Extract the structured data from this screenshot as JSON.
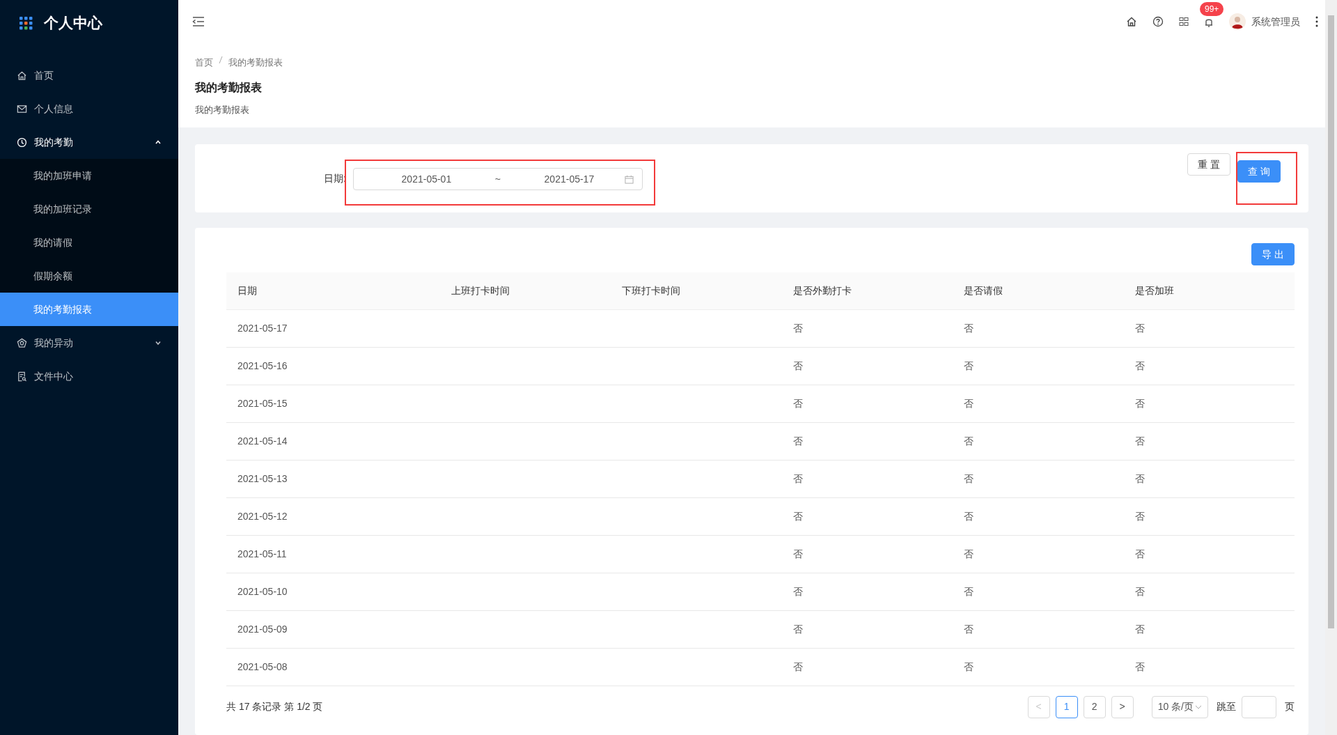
{
  "sidebar": {
    "title": "个人中心",
    "items": [
      {
        "label": "首页"
      },
      {
        "label": "个人信息"
      },
      {
        "label": "我的考勤",
        "expanded": true,
        "children": [
          {
            "label": "我的加班申请",
            "selected": false
          },
          {
            "label": "我的加班记录",
            "selected": false
          },
          {
            "label": "我的请假",
            "selected": false
          },
          {
            "label": "假期余额",
            "selected": false
          },
          {
            "label": "我的考勤报表",
            "selected": true
          }
        ]
      },
      {
        "label": "我的异动",
        "expanded": false
      },
      {
        "label": "文件中心"
      }
    ]
  },
  "header": {
    "notification_count": "99+",
    "user": "系统管理员"
  },
  "breadcrumb": [
    "首页",
    "我的考勤报表"
  ],
  "page_title": "我的考勤报表",
  "page_subtitle": "我的考勤报表",
  "filter": {
    "label": "日期:",
    "start": "2021-05-01",
    "separator": "~",
    "end": "2021-05-17",
    "highlighted": true
  },
  "filter_buttons": [
    {
      "label": "重 置",
      "kind": "default",
      "highlighted": false
    },
    {
      "label": "查 询",
      "kind": "primary",
      "highlighted": true
    }
  ],
  "export_button": "导 出",
  "table": {
    "columns": [
      "日期",
      "上班打卡时间",
      "下班打卡时间",
      "是否外勤打卡",
      "是否请假",
      "是否加班"
    ],
    "rows": [
      [
        "2021-05-17",
        null,
        null,
        "否",
        "否",
        "否"
      ],
      [
        "2021-05-16",
        null,
        null,
        "否",
        "否",
        "否"
      ],
      [
        "2021-05-15",
        null,
        null,
        "否",
        "否",
        "否"
      ],
      [
        "2021-05-14",
        null,
        null,
        "否",
        "否",
        "否"
      ],
      [
        "2021-05-13",
        null,
        null,
        "否",
        "否",
        "否"
      ],
      [
        "2021-05-12",
        null,
        null,
        "否",
        "否",
        "否"
      ],
      [
        "2021-05-11",
        null,
        null,
        "否",
        "否",
        "否"
      ],
      [
        "2021-05-10",
        null,
        null,
        "否",
        "否",
        "否"
      ],
      [
        "2021-05-09",
        null,
        null,
        "否",
        "否",
        "否"
      ],
      [
        "2021-05-08",
        null,
        null,
        "否",
        "否",
        "否"
      ]
    ]
  },
  "pagination": {
    "summary": "共 17 条记录 第 1/2 页",
    "prev": "<",
    "pages": [
      {
        "label": "1",
        "selected": true
      },
      {
        "label": "2",
        "selected": false
      }
    ],
    "next": ">",
    "page_size": "10 条/页",
    "jump_label": "跳至",
    "jump_suffix": "页"
  }
}
